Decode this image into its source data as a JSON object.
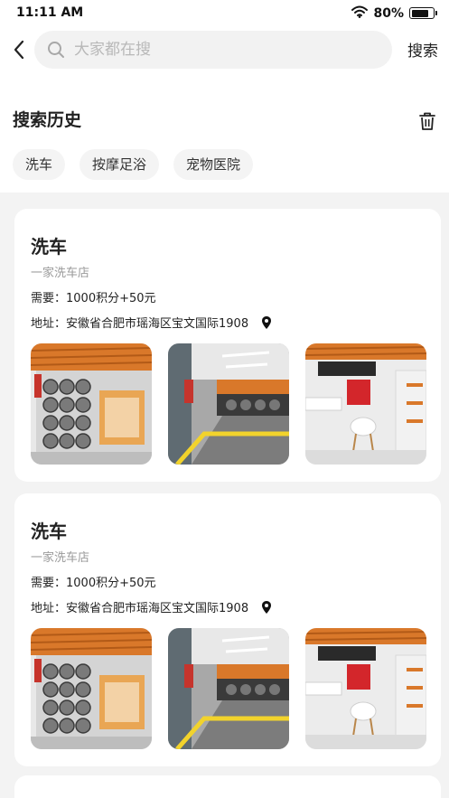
{
  "status_bar": {
    "time": "11:11 AM",
    "battery": "80%",
    "battery_level": 0.8
  },
  "header": {
    "back_icon": "chevron-left-icon",
    "search_placeholder": "大家都在搜",
    "search_value": "",
    "search_icon": "search-icon",
    "search_button": "搜索"
  },
  "history": {
    "title": "搜索历史",
    "clear_icon": "trash-icon",
    "tags": [
      "洗车",
      "按摩足浴",
      "宠物医院"
    ]
  },
  "results": [
    {
      "title": "洗车",
      "subtitle": "一家洗车店",
      "price": "需要：1000积分+50元",
      "address": "地址：安徽省合肥市瑶海区宝文国际1908",
      "location_icon": "location-pin-icon",
      "photos": [
        "tire-display-store-photo",
        "car-wash-bay-photo",
        "lounge-area-photo"
      ]
    },
    {
      "title": "洗车",
      "subtitle": "一家洗车店",
      "price": "需要：1000积分+50元",
      "address": "地址：安徽省合肥市瑶海区宝文国际1908",
      "location_icon": "location-pin-icon",
      "photos": [
        "tire-display-store-photo",
        "car-wash-bay-photo",
        "lounge-area-photo"
      ]
    }
  ],
  "colors": {
    "background": "#f3f3f3",
    "card": "#ffffff",
    "tag_bg": "#f4f4f4",
    "muted_text": "#9a9a9a",
    "accent_orange": "#d9782a"
  }
}
